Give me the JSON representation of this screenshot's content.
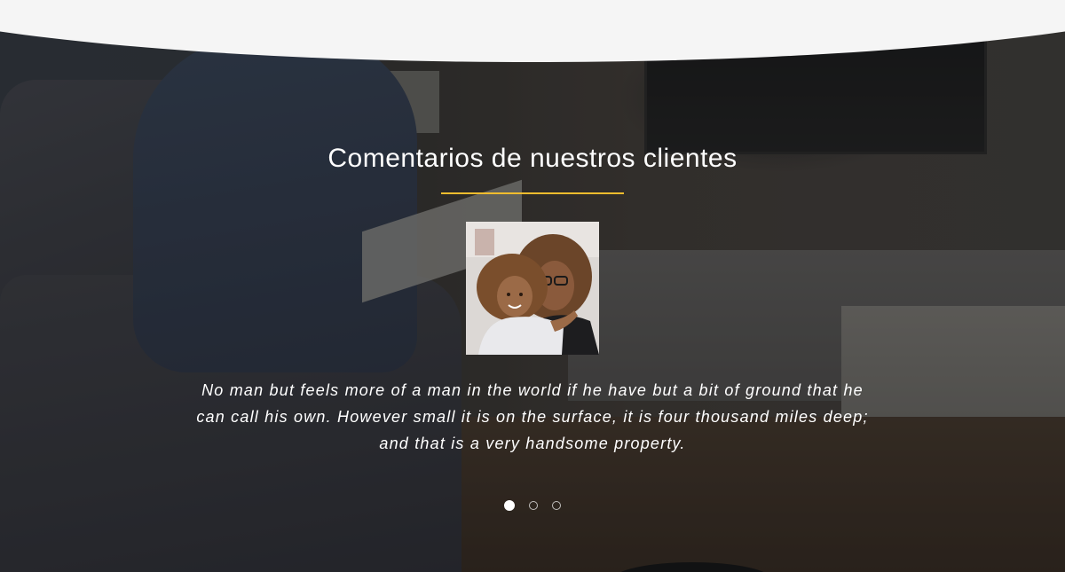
{
  "testimonials": {
    "title": "Comentarios de nuestros clientes",
    "accent_color": "#f4bd2e",
    "avatar_icon": "customer-photo",
    "quote": "No man but feels more of a man in the world if he have but a bit of ground that he can call his own. However small it is on the surface, it is four thousand miles deep; and that is a very handsome property.",
    "pagination": {
      "total": 3,
      "active": 1
    }
  }
}
